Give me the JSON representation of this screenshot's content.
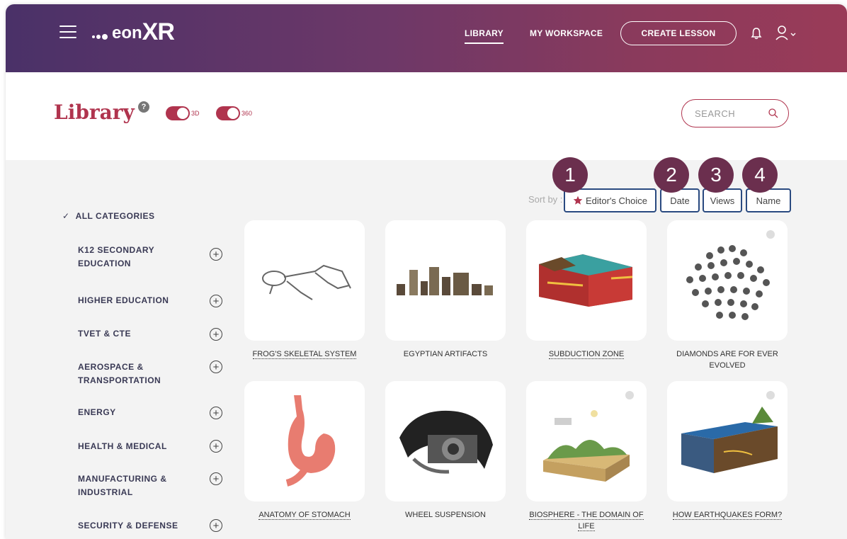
{
  "brand": {
    "logo_text_eon": "eon",
    "logo_text_xr": "XR"
  },
  "nav": {
    "library": "LIBRARY",
    "workspace": "MY WORKSPACE",
    "create": "CREATE LESSON"
  },
  "page": {
    "title": "Library",
    "toggle_3d": "3D",
    "toggle_360": "360",
    "search_placeholder": "SEARCH"
  },
  "sort": {
    "label": "Sort by :",
    "editors_choice": "Editor's Choice",
    "date": "Date",
    "views": "Views",
    "name": "Name",
    "badges": [
      "1",
      "2",
      "3",
      "4"
    ]
  },
  "categories": {
    "all": "ALL CATEGORIES",
    "items": [
      "K12 SECONDARY EDUCATION",
      "HIGHER EDUCATION",
      "TVET & CTE",
      "AEROSPACE & TRANSPORTATION",
      "ENERGY",
      "HEALTH & MEDICAL",
      "MANUFACTURING & INDUSTRIAL",
      "SECURITY & DEFENSE"
    ]
  },
  "cards": [
    "FROG'S SKELETAL SYSTEM",
    "EGYPTIAN ARTIFACTS",
    "SUBDUCTION ZONE",
    "DIAMONDS ARE FOR EVER EVOLVED",
    "ANATOMY OF STOMACH",
    "WHEEL SUSPENSION",
    "BIOSPHERE - THE DOMAIN OF LIFE",
    "HOW EARTHQUAKES FORM?"
  ],
  "colors": {
    "accent": "#b0344e",
    "badge": "#6b2f4e",
    "sort_border": "#2a4a80"
  }
}
